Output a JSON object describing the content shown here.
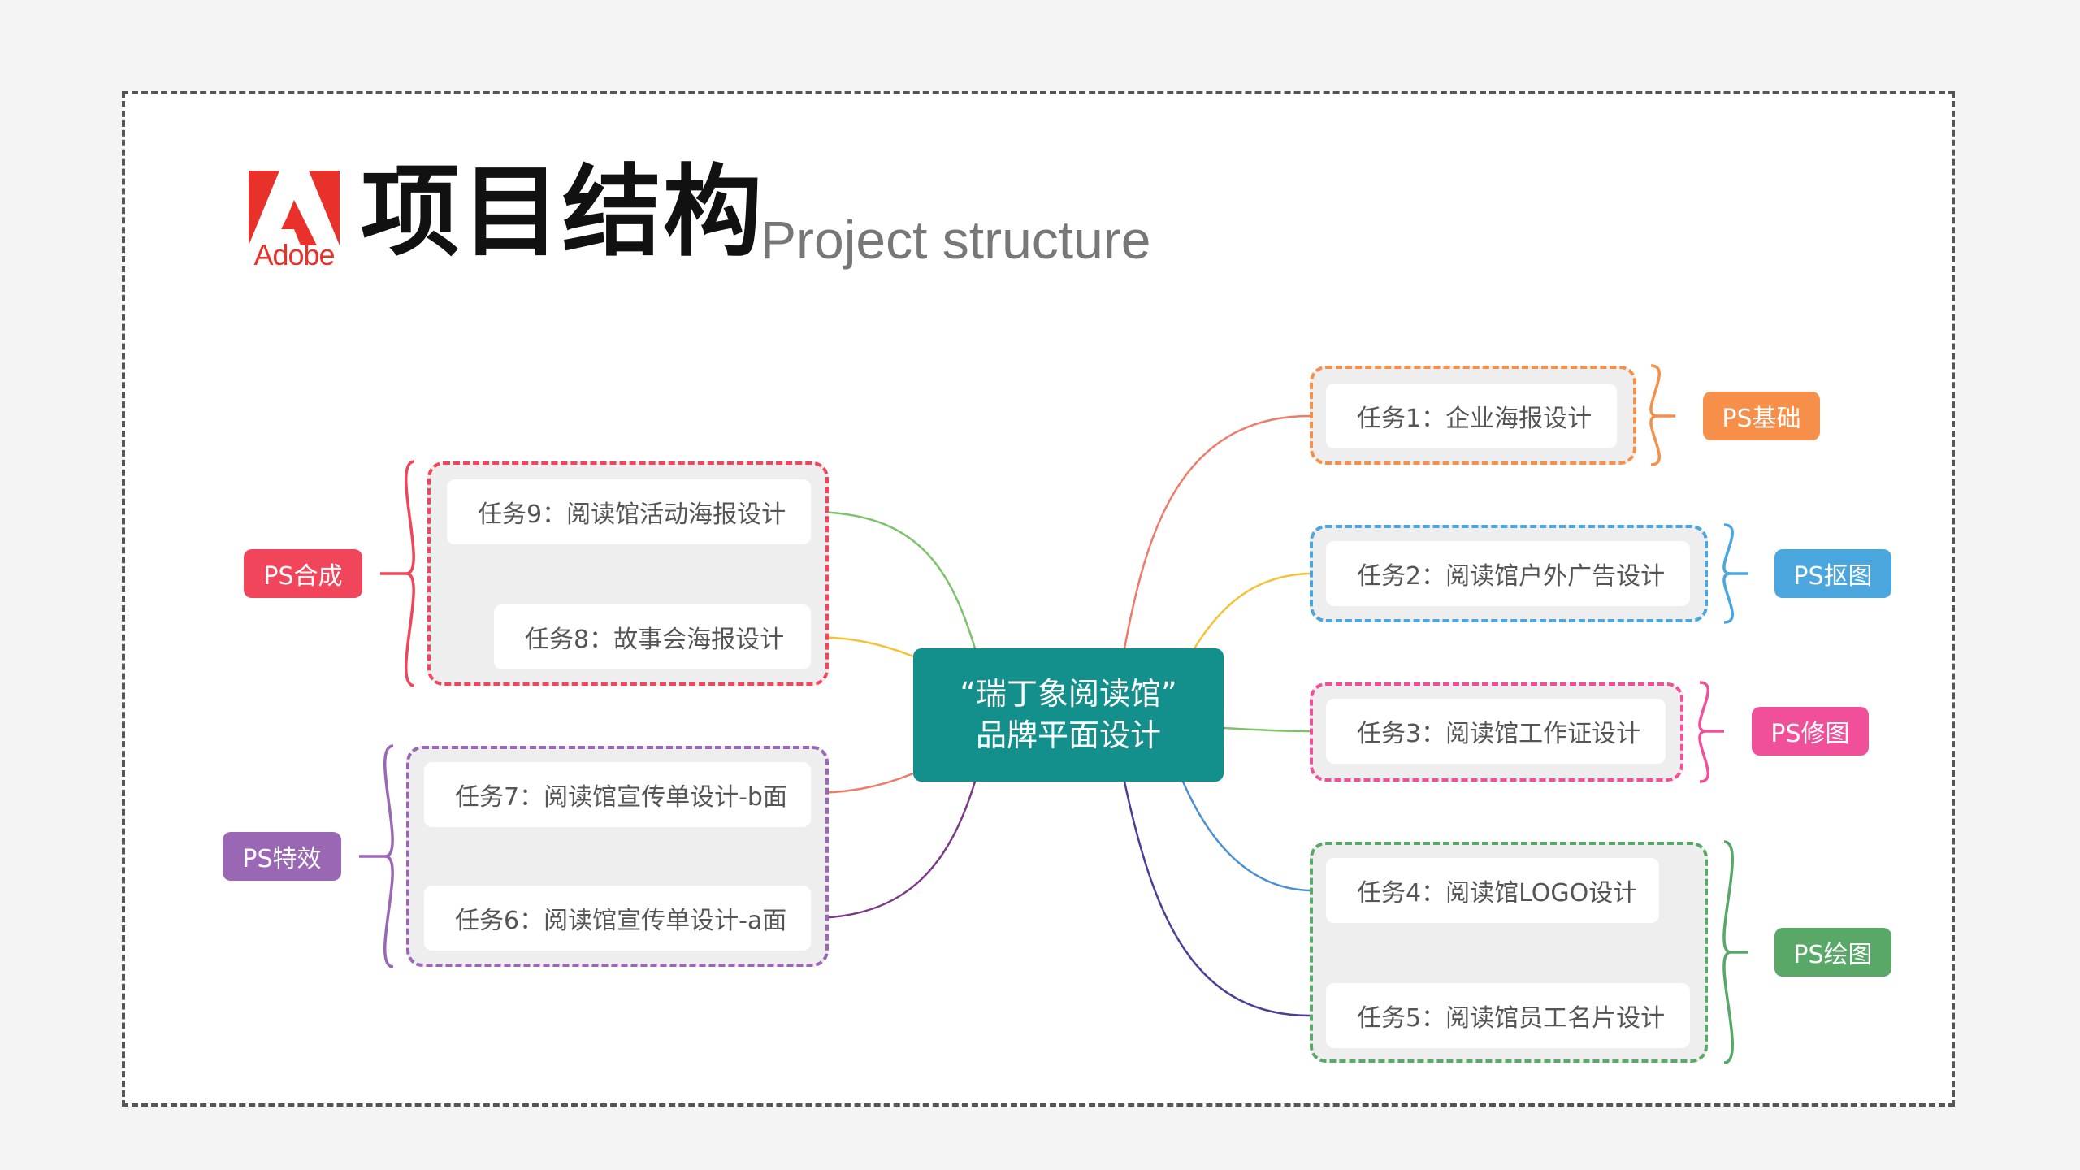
{
  "header": {
    "logo_word": "Adobe",
    "title_zh": "项目结构",
    "title_en": "Project structure"
  },
  "center": {
    "line1": "“瑞丁象阅读馆”",
    "line2": "品牌平面设计"
  },
  "tasks": {
    "t1": "任务1：企业海报设计",
    "t2": "任务2：阅读馆户外广告设计",
    "t3": "任务3：阅读馆工作证设计",
    "t4": "任务4：阅读馆LOGO设计",
    "t5": "任务5：阅读馆员工名片设计",
    "t6": "任务6：阅读馆宣传单设计-a面",
    "t7": "任务7：阅读馆宣传单设计-b面",
    "t8": "任务8：故事会海报设计",
    "t9": "任务9：阅读馆活动海报设计"
  },
  "categories": {
    "basic": "PS基础",
    "cutout": "PS抠图",
    "retouch": "PS修图",
    "drawing": "PS绘图",
    "composite": "PS合成",
    "effects": "PS特效"
  },
  "colors": {
    "orange": "#f58f4a",
    "blue": "#4aa6dc",
    "pink": "#f0509a",
    "green": "#5aa868",
    "red": "#f0455a",
    "purple": "#9a67b4",
    "center": "#138f8c"
  }
}
